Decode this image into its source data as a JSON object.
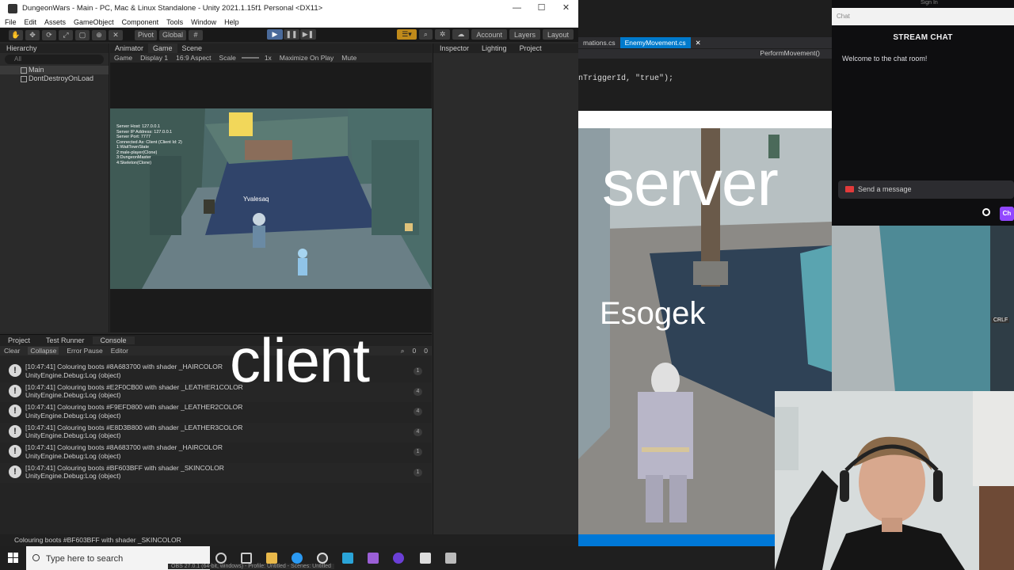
{
  "unity": {
    "window_title": "DungeonWars - Main - PC, Mac & Linux Standalone - Unity 2021.1.15f1 Personal <DX11>",
    "window_controls": [
      "—",
      "☐",
      "✕"
    ],
    "menu": [
      "File",
      "Edit",
      "Assets",
      "GameObject",
      "Component",
      "Tools",
      "Window",
      "Help"
    ],
    "toolbar": {
      "pivot": "Pivot",
      "global": "Global",
      "account": "Account",
      "layers": "Layers",
      "layout": "Layout"
    },
    "hierarchy": {
      "tab": "Hierarchy",
      "search_placeholder": "All",
      "items": [
        "Main",
        "DontDestroyOnLoad"
      ]
    },
    "game": {
      "tabs": [
        "Animator",
        "Game",
        "Scene"
      ],
      "options": [
        "Game",
        "Display 1",
        "16:9 Aspect",
        "Scale",
        "1x",
        "Maximize On Play",
        "Mute"
      ],
      "overlay_lines": [
        "Server Host: 127.0.0.1",
        "Server IP Address: 127.0.0.1",
        "Server Port: 7777",
        "Connected As: Client (Client Id: 2)",
        "1:WaitTownState",
        "2:male-player(Clone)",
        "3:DungeonMaster",
        "4:Skeleton(Clone)"
      ],
      "player_name": "Yvalesaq"
    },
    "inspector": {
      "tabs": [
        "Inspector",
        "Lighting",
        "Project"
      ]
    },
    "console": {
      "tabs": [
        "Project",
        "Test Runner",
        "Console"
      ],
      "toolbar": [
        "Clear",
        "Collapse",
        "Error Pause",
        "Editor"
      ],
      "counts": [
        "0",
        "0"
      ],
      "logs": [
        {
          "line1": "[10:47:41] Colouring boots #8A683700 with shader _HAIRCOLOR",
          "line2": "UnityEngine.Debug:Log (object)",
          "count": "1"
        },
        {
          "line1": "[10:47:41] Colouring boots #E2F0CB00 with shader _LEATHER1COLOR",
          "line2": "UnityEngine.Debug:Log (object)",
          "count": "4"
        },
        {
          "line1": "[10:47:41] Colouring boots #F9EFD800 with shader _LEATHER2COLOR",
          "line2": "UnityEngine.Debug:Log (object)",
          "count": "4"
        },
        {
          "line1": "[10:47:41] Colouring boots #E8D3B800 with shader _LEATHER3COLOR",
          "line2": "UnityEngine.Debug:Log (object)",
          "count": "4"
        },
        {
          "line1": "[10:47:41] Colouring boots #8A683700 with shader _HAIRCOLOR",
          "line2": "UnityEngine.Debug:Log (object)",
          "count": "1"
        },
        {
          "line1": "[10:47:41] Colouring boots #BF603BFF with shader _SKINCOLOR",
          "line2": "UnityEngine.Debug:Log (object)",
          "count": "1"
        }
      ]
    },
    "status_bar": "Colouring boots #BF603BFF with shader _SKINCOLOR",
    "overlay_client": "client"
  },
  "editor": {
    "tabs": [
      "mations.cs",
      "EnemyMovement.cs"
    ],
    "nav": "PerformMovement()",
    "code": "nTriggerId, \"true\");"
  },
  "server": {
    "overlay_server": "server",
    "player_tag": "Esogek"
  },
  "chat": {
    "header": "Chat",
    "title": "STREAM CHAT",
    "welcome": "Welcome to the chat room!",
    "input_placeholder": "Send a message",
    "button": "Ch",
    "top_text": "Sign In"
  },
  "taskbar": {
    "search": "Type here to search",
    "obs": "OBS 27.0.1 (64-bit, windows) - Profile: Untitled - Scenes: Untitled"
  },
  "side_labels": [
    "CRLF"
  ]
}
